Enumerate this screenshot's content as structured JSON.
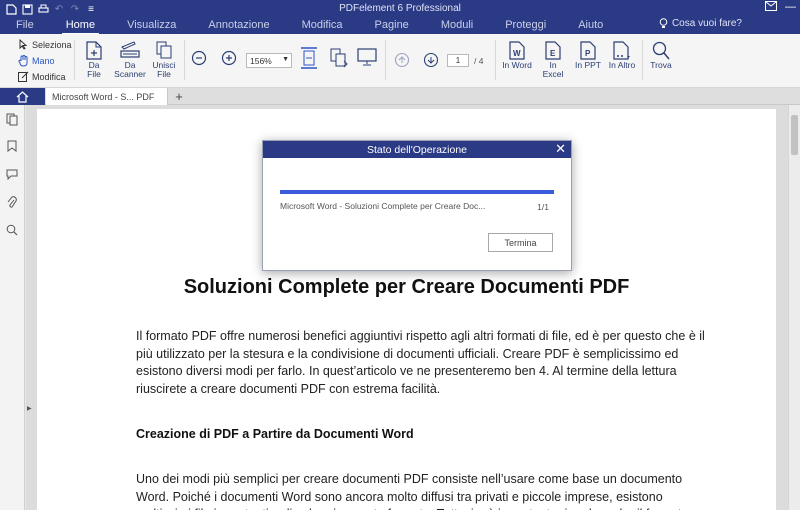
{
  "app": {
    "title": "PDFelement 6 Professional",
    "accent_color": "#2b3a84",
    "quick_access": [
      "pdf-logo-icon",
      "save-icon",
      "print-icon",
      "undo-icon",
      "redo-icon",
      "quick-menu-icon"
    ],
    "window_controls": [
      "mail-icon",
      "minimize-icon"
    ]
  },
  "menu": {
    "items": [
      "File",
      "Home",
      "Visualizza",
      "Annotazione",
      "Modifica",
      "Pagine",
      "Moduli",
      "Proteggi",
      "Aiuto"
    ],
    "active": "Home",
    "search_hint": "Cosa vuoi fare?"
  },
  "ribbon": {
    "modes": {
      "select": "Seleziona",
      "hand": "Mano",
      "edit": "Modifica"
    },
    "create": {
      "from_file": "Da File",
      "scanner_line1": "Da",
      "scanner_line2": "Scanner",
      "combine_line1": "Unisci",
      "combine_line2": "File"
    },
    "zoom_value": "156%",
    "page_current": "1",
    "page_total": "/ 4",
    "convert": {
      "word": "In Word",
      "excel": "In Excel",
      "ppt": "In PPT",
      "other": "In Altro"
    },
    "find": "Trova"
  },
  "tabs": {
    "document_tab": "Microsoft Word - S... PDF"
  },
  "document": {
    "title": "Soluzioni Complete per Creare Documenti PDF",
    "para1": "Il formato PDF offre numerosi benefici aggiuntivi rispetto agli altri formati di file, ed è per questo che è il più utilizzato per la stesura e la condivisione di documenti ufficiali. Creare PDF è semplicissimo ed esistono diversi modi per farlo. In quest’articolo ve ne presenteremo ben 4. Al termine della lettura riuscirete a creare documenti PDF con estrema facilità.",
    "heading1": "Creazione di PDF a Partire da Documenti Word",
    "para2": "Uno dei modi più semplici per creare documenti PDF consiste nell’usare come base un documento Word. Poiché i documenti Word sono ancora molto diffusi tra privati e piccole imprese, esistono moltissimi file importanti e di valore in questo formato. Tuttavia, è importante ricordare che il formato"
  },
  "dialog": {
    "title": "Stato dell'Operazione",
    "file_name": "Microsoft Word - Soluzioni Complete per Creare Doc...",
    "count": "1/1",
    "progress": 1.0,
    "button": "Termina"
  }
}
